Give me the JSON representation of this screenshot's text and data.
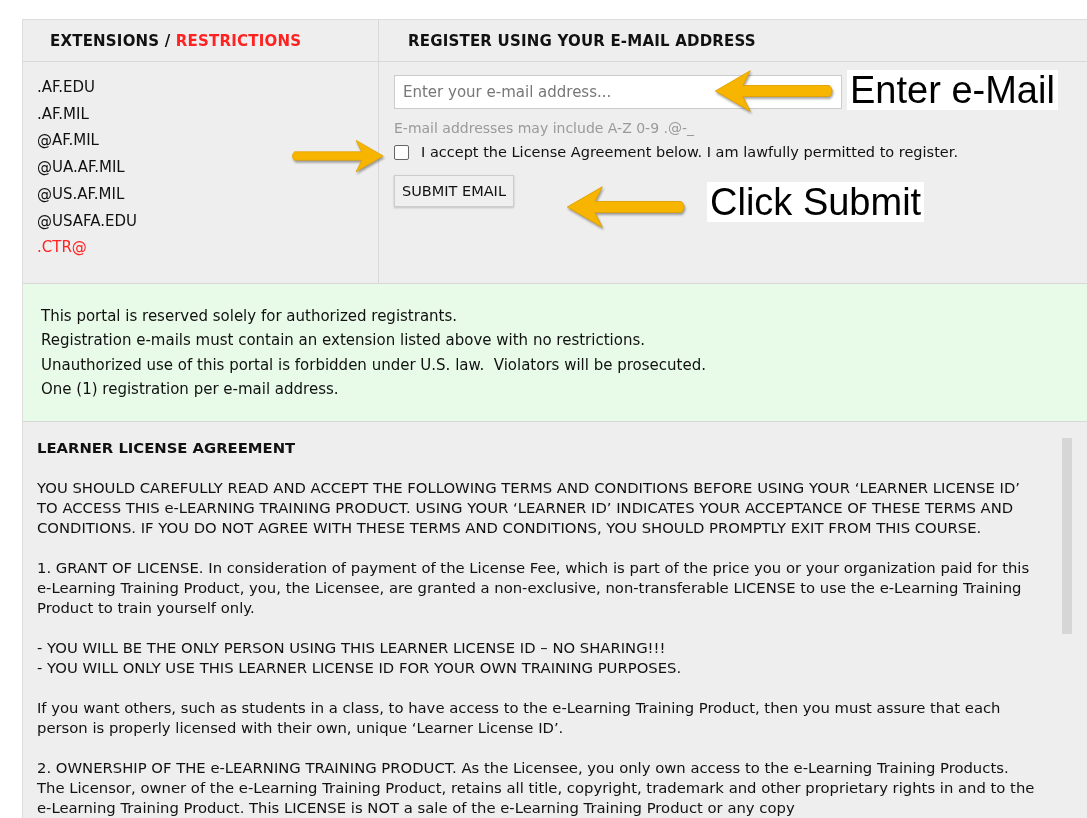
{
  "extensions_panel": {
    "heading": "EXTENSIONS",
    "separator": "/",
    "heading_restricted": "RESTRICTIONS",
    "items": [
      {
        "text": ".AF.EDU",
        "restricted": false
      },
      {
        "text": ".AF.MIL",
        "restricted": false
      },
      {
        "text": "@AF.MIL",
        "restricted": false
      },
      {
        "text": "@UA.AF.MIL",
        "restricted": false
      },
      {
        "text": "@US.AF.MIL",
        "restricted": false
      },
      {
        "text": "@USAFA.EDU",
        "restricted": false
      },
      {
        "text": ".CTR@",
        "restricted": true
      }
    ]
  },
  "register_panel": {
    "heading": "REGISTER USING YOUR E-MAIL ADDRESS",
    "email_field": {
      "placeholder": "Enter your e-mail address..."
    },
    "hint": "E-mail addresses may include A-Z 0-9 .@-_",
    "accept": {
      "label": "I accept the License Agreement below. I am lawfully permitted to register.",
      "checked": false
    },
    "submit_button": "SUBMIT EMAIL"
  },
  "notice": [
    "This portal is reserved solely for authorized registrants.",
    "Registration e-mails must contain an extension listed above with no restrictions.",
    "Unauthorized use of this portal is forbidden under U.S. law.  Violators will be prosecuted.",
    "One (1) registration per e-mail address."
  ],
  "license": {
    "title": "LEARNER LICENSE AGREEMENT",
    "paragraphs": [
      [
        "YOU SHOULD CAREFULLY READ AND ACCEPT THE FOLLOWING TERMS AND CONDITIONS BEFORE USING YOUR ‘LEARNER LICENSE ID’ TO ACCESS THIS e-LEARNING TRAINING PRODUCT. USING YOUR ‘LEARNER ID’ INDICATES YOUR ACCEPTANCE OF THESE TERMS AND CONDITIONS. IF YOU DO NOT AGREE WITH THESE TERMS AND CONDITIONS, YOU SHOULD PROMPTLY EXIT FROM THIS COURSE."
      ],
      [
        "1. GRANT OF LICENSE. In consideration of payment of the License Fee, which is part of the price you or your organization paid for this e-Learning Training Product, you, the Licensee, are granted a non-exclusive, non-transferable LICENSE to use the e-Learning Training Product to train yourself only."
      ],
      [
        "- YOU WILL BE THE ONLY PERSON USING THIS LEARNER LICENSE ID – NO SHARING!!!",
        "- YOU WILL ONLY USE THIS LEARNER LICENSE ID FOR YOUR OWN TRAINING PURPOSES."
      ],
      [
        "If you want others, such as students in a class, to have access to the e-Learning Training Product, then you must assure that each person is properly licensed with their own, unique ‘Learner License ID’."
      ],
      [
        "2. OWNERSHIP OF THE e-LEARNING TRAINING PRODUCT. As the Licensee, you only own access to the e-Learning Training Products. The Licensor, owner of the e-Learning Training Product, retains all title, copyright, trademark and other proprietary rights in and to the e-Learning Training Product. This LICENSE is NOT a sale of the e-Learning Training Product or any copy"
      ]
    ]
  },
  "annotations": [
    {
      "text": "Enter e-Mail"
    },
    {
      "text": "Click Submit"
    }
  ]
}
